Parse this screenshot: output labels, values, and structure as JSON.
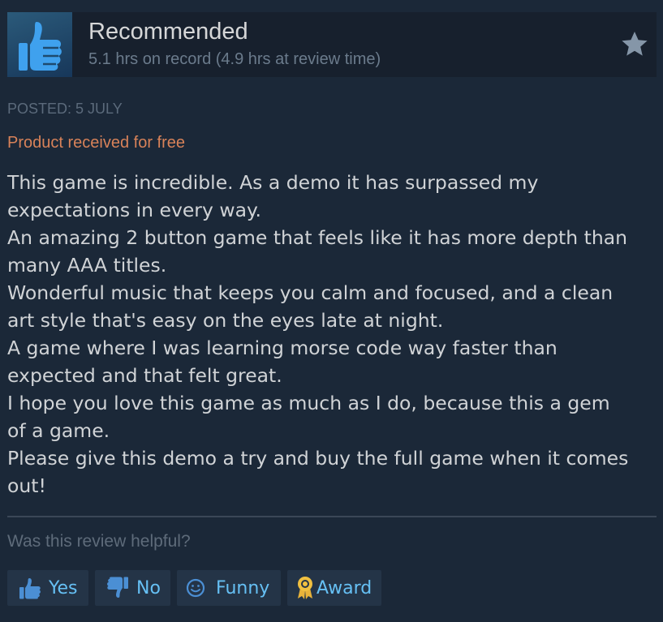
{
  "review": {
    "verdict": "Recommended",
    "hours": "5.1 hrs on record (4.9 hrs at review time)",
    "posted": "POSTED: 5 JULY",
    "received_note": "Product received for free",
    "body_lines": [
      "This game is incredible. As a demo it has surpassed my",
      "expectations in every way.",
      "An amazing 2 button game that feels like it has more depth than",
      "many AAA titles.",
      "Wonderful music that keeps you calm and focused, and a clean",
      "art style that's easy on the eyes late at night.",
      "A game where I was learning morse code way faster than",
      "expected and that felt great.",
      "I hope you love this game as much as I do, because this a gem",
      "of a game.",
      "Please give this demo a try and buy the full game when it comes",
      "out!"
    ]
  },
  "feedback": {
    "prompt": "Was this review helpful?",
    "buttons": {
      "yes": "Yes",
      "no": "No",
      "funny": "Funny",
      "award": "Award"
    }
  },
  "icons": {
    "verdict": "thumbs-up-icon",
    "favorite": "star-icon",
    "yes": "thumbs-up-icon",
    "no": "thumbs-down-icon",
    "funny": "smiley-icon",
    "award": "award-ribbon-icon"
  },
  "colors": {
    "background": "#1b2838",
    "header_bg": "#17202d",
    "accent": "#66c0f4",
    "received_note": "#d88259",
    "button_bg": "#243447"
  }
}
